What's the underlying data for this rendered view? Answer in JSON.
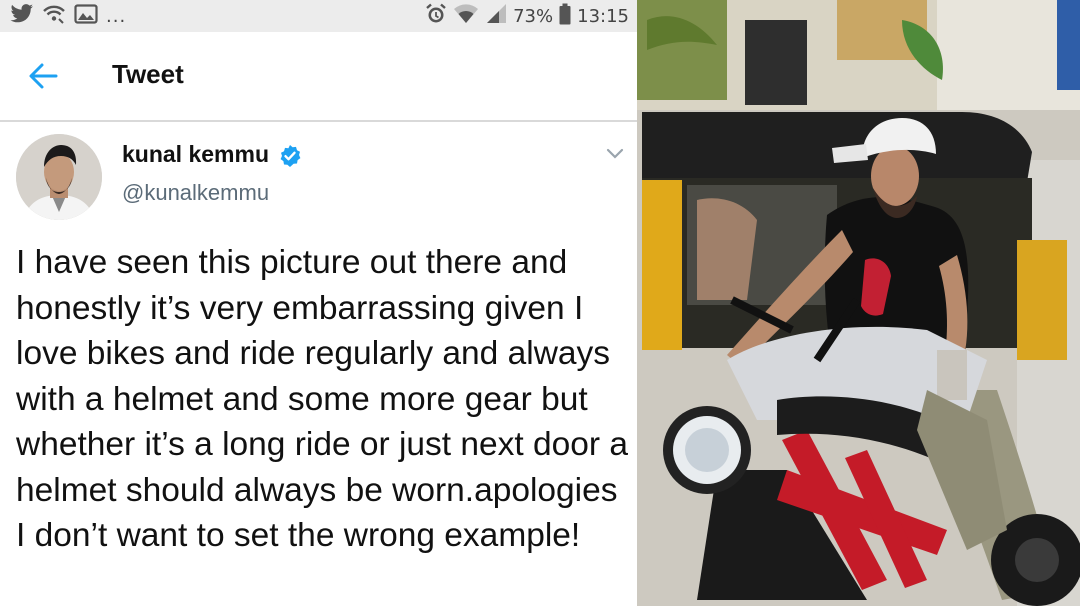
{
  "status_bar": {
    "left_dots": "...",
    "battery": "73%",
    "time": "13:15"
  },
  "header": {
    "title": "Tweet"
  },
  "tweet": {
    "display_name": "kunal kemmu",
    "handle": "@kunalkemmu",
    "text": "I have seen this picture out there and honestly it’s very embarrassing given I love bikes and ride regularly and always with a helmet and some more gear but whether it’s a long ride or just next door a helmet should always be worn.apologies I don’t want to set the wrong example!"
  },
  "icons": [
    "twitter-bird-icon",
    "wifi-call-icon",
    "gallery-icon",
    "alarm-icon",
    "wifi-icon",
    "signal-icon",
    "battery-icon",
    "back-arrow-icon",
    "verified-badge-icon",
    "chevron-down-icon"
  ],
  "colors": {
    "accent": "#1da1f2",
    "status_bar_bg": "#ececec",
    "handle_gray": "#5b6b78"
  }
}
